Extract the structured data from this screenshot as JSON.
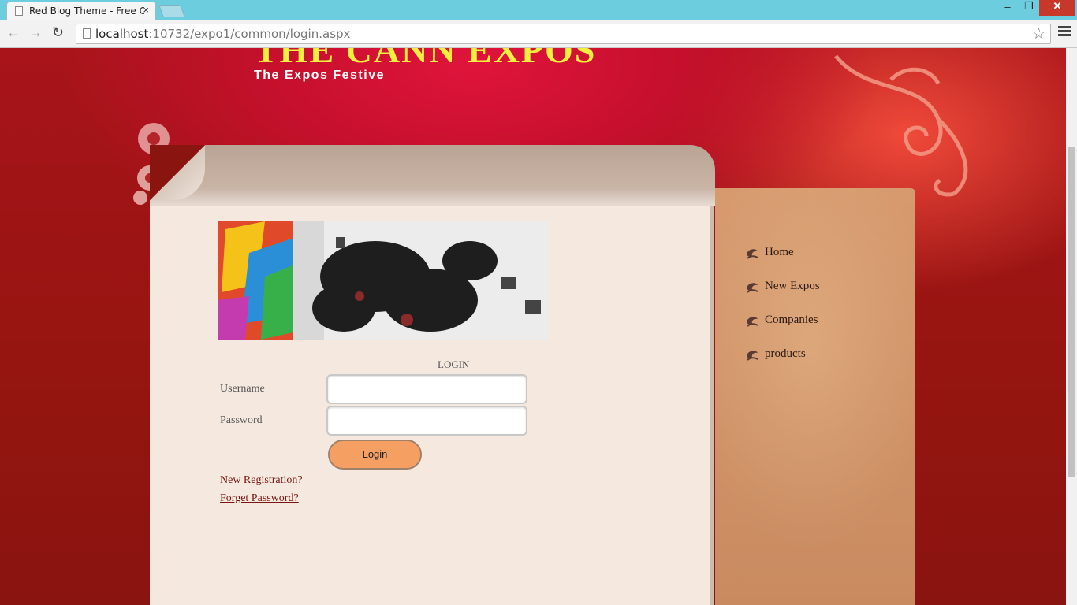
{
  "browser": {
    "tab_title": "Red Blog Theme - Free CS",
    "tab_close": "×",
    "url_host": "localhost",
    "url_path": ":10732/expo1/common/login.aspx",
    "window_min": "–",
    "window_max": "❐",
    "window_close": "✕",
    "back_glyph": "←",
    "forward_glyph": "→",
    "reload_glyph": "↻",
    "star_glyph": "☆"
  },
  "site": {
    "title": "THE CANN EXPOS",
    "tagline": "The Expos Festive"
  },
  "login": {
    "heading": "LOGIN",
    "username_label": "Username",
    "password_label": "Password",
    "username_value": "",
    "password_value": "",
    "button_label": "Login",
    "new_registration": "New Registration?",
    "forget_password": "Forget Password?"
  },
  "sidebar": {
    "items": [
      {
        "label": "Home"
      },
      {
        "label": "New Expos"
      },
      {
        "label": "Companies"
      },
      {
        "label": "products"
      }
    ]
  },
  "colors": {
    "page_background": "#8b1410",
    "title_yellow": "#f3ef40",
    "login_button": "#f5a062",
    "content_panel": "#f4e8df",
    "sidebar": "#cf9266",
    "link": "#7a1712"
  }
}
